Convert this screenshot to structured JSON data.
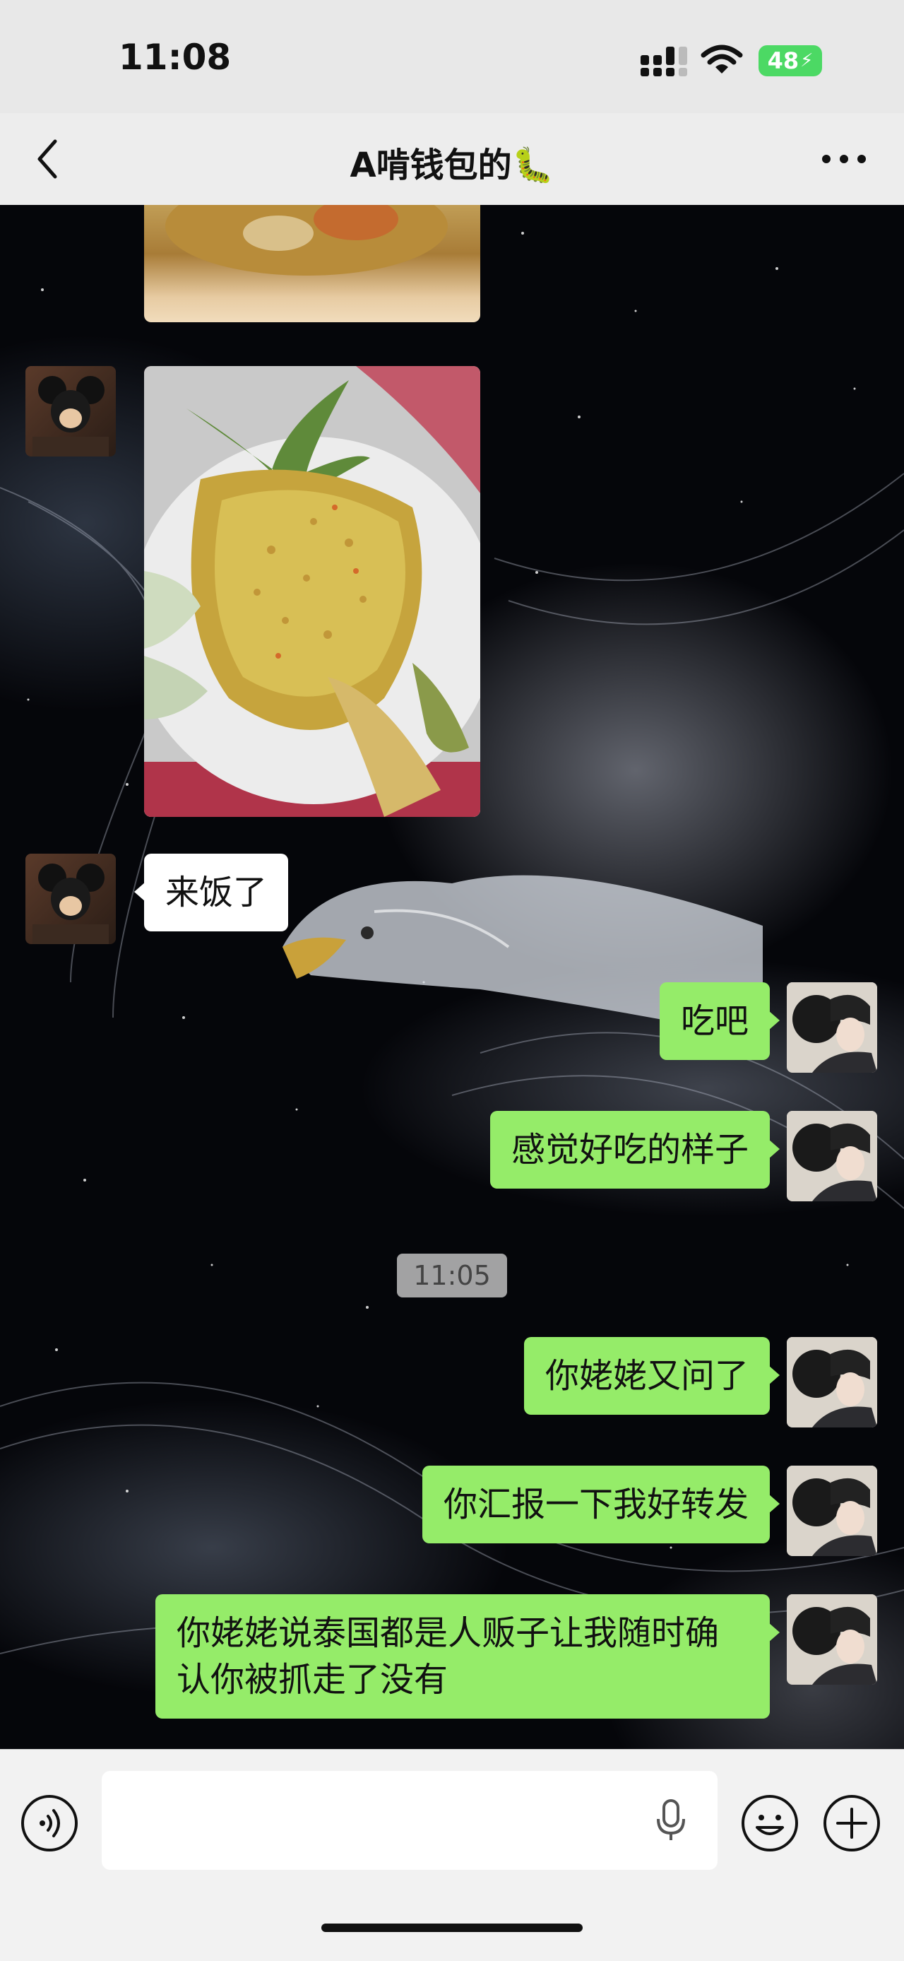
{
  "status_bar": {
    "time": "11:08",
    "battery": "48",
    "icons": [
      "signal-icon",
      "wifi-icon",
      "battery-charging-icon"
    ]
  },
  "nav": {
    "title": "A啃钱包的🐛",
    "back_icon": "chevron-left-icon",
    "more_icon": "more-dots-icon"
  },
  "messages": [
    {
      "side": "left",
      "type": "image",
      "content": "food-photo-curry"
    },
    {
      "side": "left",
      "type": "image",
      "content": "food-photo-pineapple-fried-rice"
    },
    {
      "side": "left",
      "type": "text",
      "text": "来饭了"
    },
    {
      "side": "right",
      "type": "text",
      "text": "吃吧"
    },
    {
      "side": "right",
      "type": "text",
      "text": "感觉好吃的样子"
    },
    {
      "side": "right",
      "type": "text",
      "text": "你姥姥又问了"
    },
    {
      "side": "right",
      "type": "text",
      "text": "你汇报一下我好转发"
    },
    {
      "side": "right",
      "type": "text",
      "text": "你姥姥说泰国都是人贩子让我随时确认你被抓走了没有"
    }
  ],
  "timestamp": "11:05",
  "input_bar": {
    "placeholder": "",
    "icons": [
      "voice-icon",
      "mic-icon",
      "emoji-icon",
      "plus-icon"
    ]
  },
  "colors": {
    "bubble_sent": "#95ec69",
    "bubble_received": "#ffffff",
    "battery": "#4cd964"
  }
}
